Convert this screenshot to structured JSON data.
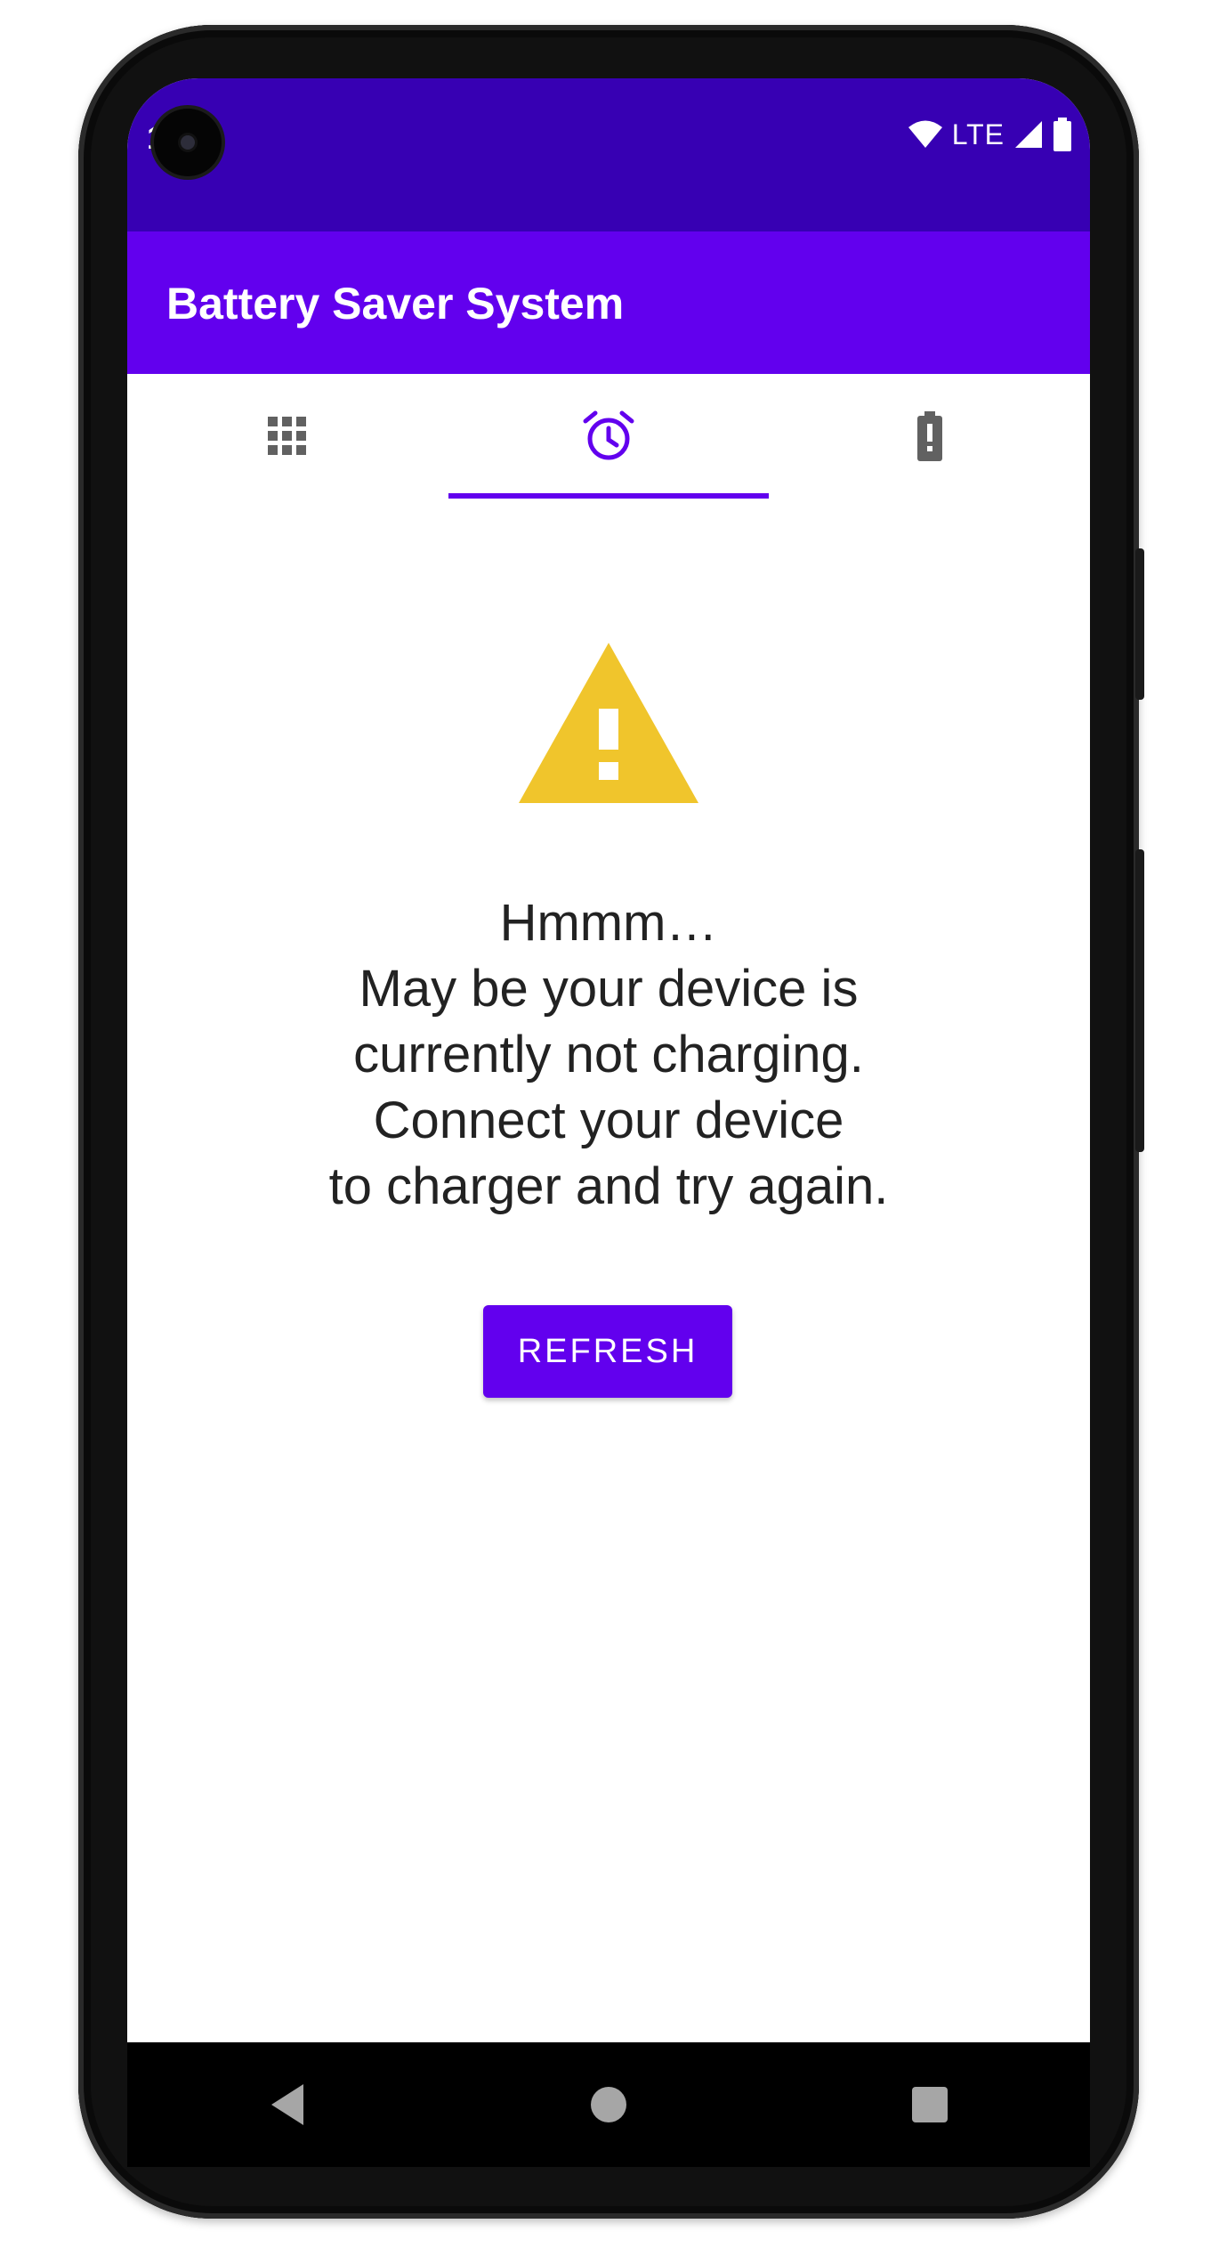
{
  "status_bar": {
    "time": "1 0"
  },
  "status_icons": {
    "network": "LTE"
  },
  "app_bar": {
    "title": "Battery Saver System"
  },
  "tabs": [
    {
      "icon": "grid-icon",
      "active": false
    },
    {
      "icon": "alarm-clock-icon",
      "active": true
    },
    {
      "icon": "battery-alert-icon",
      "active": false
    }
  ],
  "main": {
    "warning_icon": "warning-triangle-icon",
    "message_lines": [
      "Hmmm…",
      "May be your device is",
      "currently not charging.",
      "Connect your device",
      "to charger and try again."
    ],
    "refresh_label": "REFRESH"
  },
  "nav_bar": {
    "buttons": [
      "back-icon",
      "home-icon",
      "recents-icon"
    ]
  },
  "colors": {
    "status_bar": "#3700b3",
    "app_bar": "#6200ee",
    "accent": "#6200ee",
    "warning": "#f0c52c",
    "inactive_icon": "#616161"
  }
}
